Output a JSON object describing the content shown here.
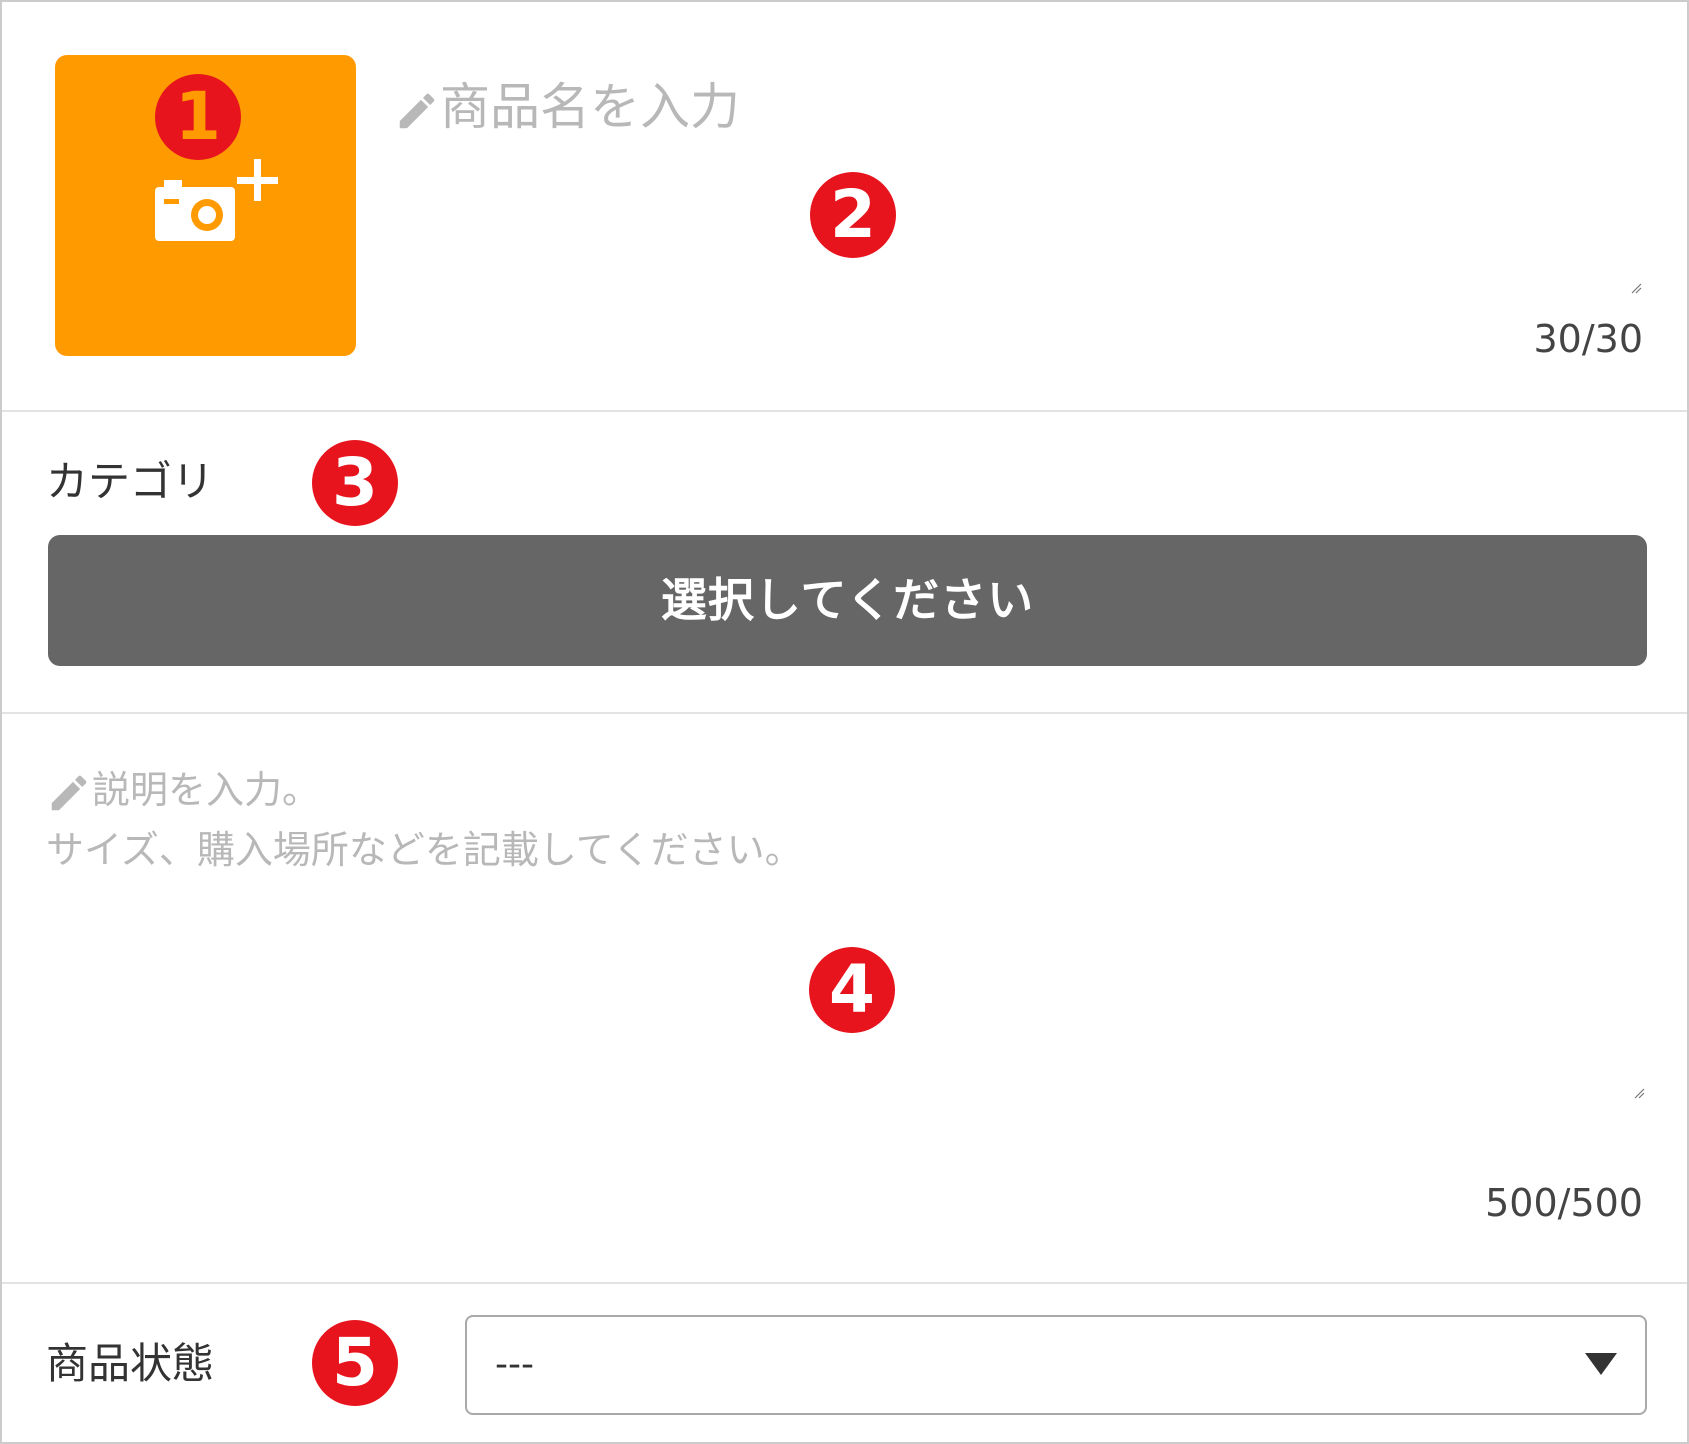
{
  "photo": {
    "marker": "1",
    "icon": "camera-plus-icon",
    "color": "#ff9a00"
  },
  "product_name": {
    "icon": "pencil-icon",
    "placeholder": "商品名を入力",
    "marker": "2",
    "counter": "30/30"
  },
  "category": {
    "label": "カテゴリ",
    "marker": "3",
    "button_label": "選択してください"
  },
  "description": {
    "icon": "pencil-icon",
    "placeholder_line1": "説明を入力。",
    "placeholder_line2": "サイズ、購入場所などを記載してください。",
    "marker": "4",
    "counter": "500/500"
  },
  "condition": {
    "label": "商品状態",
    "marker": "5",
    "selected_value": "---"
  },
  "colors": {
    "accent": "#ff9a00",
    "marker": "#e8141d",
    "button": "#666666"
  }
}
